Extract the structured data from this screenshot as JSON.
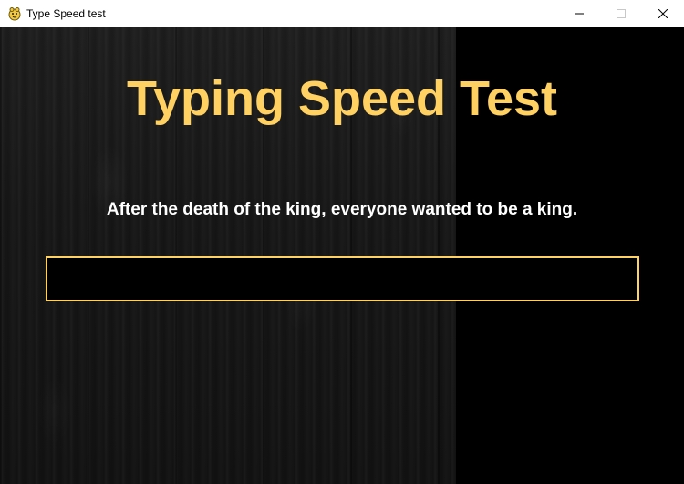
{
  "window": {
    "title": "Type Speed test",
    "icon": "pygame-snake-icon",
    "controls": [
      "minimize-icon",
      "maximize-icon",
      "close-icon"
    ]
  },
  "game": {
    "heading": "Typing Speed Test",
    "sentence": "After the death of the king, everyone wanted to be a king.",
    "input": {
      "value": "",
      "placeholder": ""
    }
  },
  "colors": {
    "accent": "#ffd062",
    "background": "#000000",
    "sentence_text": "#ffffff",
    "titlebar": "#ffffff"
  }
}
